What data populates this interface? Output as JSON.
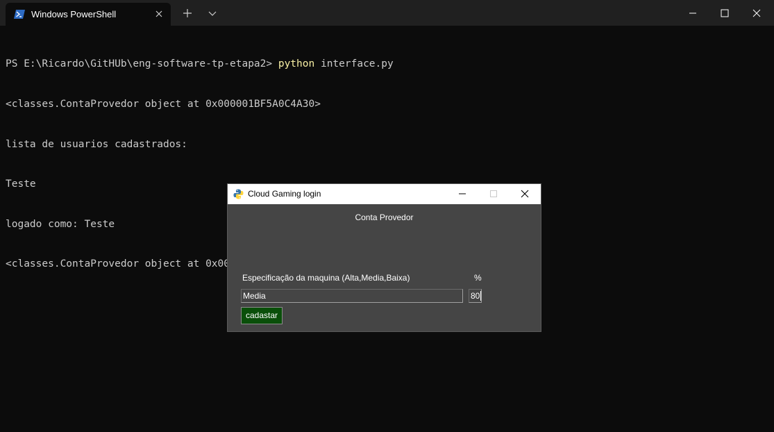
{
  "terminal": {
    "tab_title": "Windows PowerShell",
    "tab_icon": "powershell-icon",
    "lines": [
      {
        "prompt": "PS E:\\Ricardo\\GitHUb\\eng-software-tp-etapa2> ",
        "command": "python",
        "args": " interface.py"
      },
      {
        "text": "<classes.ContaProvedor object at 0x000001BF5A0C4A30>"
      },
      {
        "text": "lista de usuarios cadastrados:"
      },
      {
        "text": "Teste"
      },
      {
        "text": "logado como: Teste"
      },
      {
        "text": "<classes.ContaProvedor object at 0x000001BF5A0C4A30>"
      }
    ]
  },
  "dialog": {
    "title": "Cloud Gaming login",
    "icon": "python-icon",
    "heading": "Conta Provedor",
    "spec_label": "Especificação da maquina (Alta,Media,Baixa)",
    "percent_label": "%",
    "spec_value": "Media",
    "percent_value": "80",
    "submit_label": "cadastar"
  },
  "colors": {
    "terminal_bg": "#0c0c0c",
    "terminal_text": "#cccccc",
    "command_highlight": "#f9f1a5",
    "dialog_bg": "#454545",
    "button_bg": "#0a4f0a"
  }
}
